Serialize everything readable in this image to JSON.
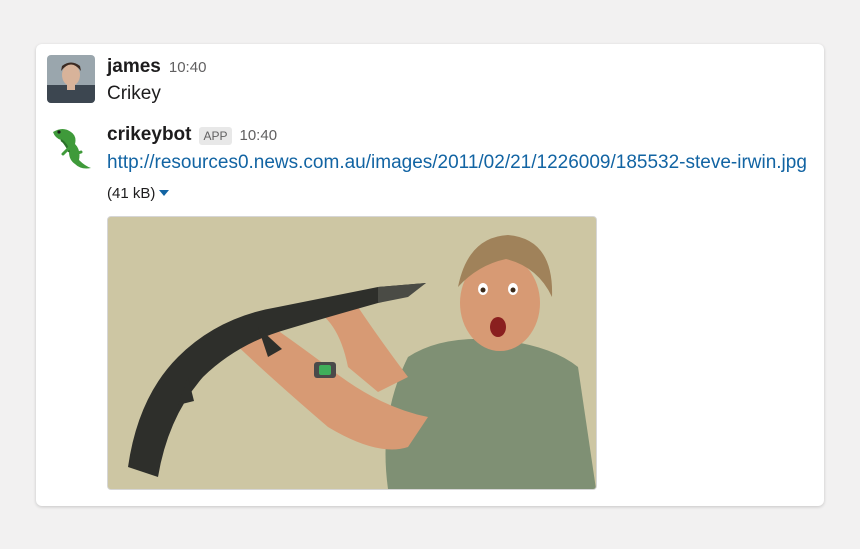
{
  "messages": [
    {
      "author": "james",
      "time": "10:40",
      "text": "Crikey"
    },
    {
      "author": "crikeybot",
      "badge": "APP",
      "time": "10:40",
      "link_text": "http://resources0.news.com.au/images/2011/02/21/1226009/185532-steve-irwin.jpg",
      "file_size": "(41 kB)"
    }
  ],
  "colors": {
    "link": "#1264a3",
    "image_background": "#cdc6a3"
  }
}
